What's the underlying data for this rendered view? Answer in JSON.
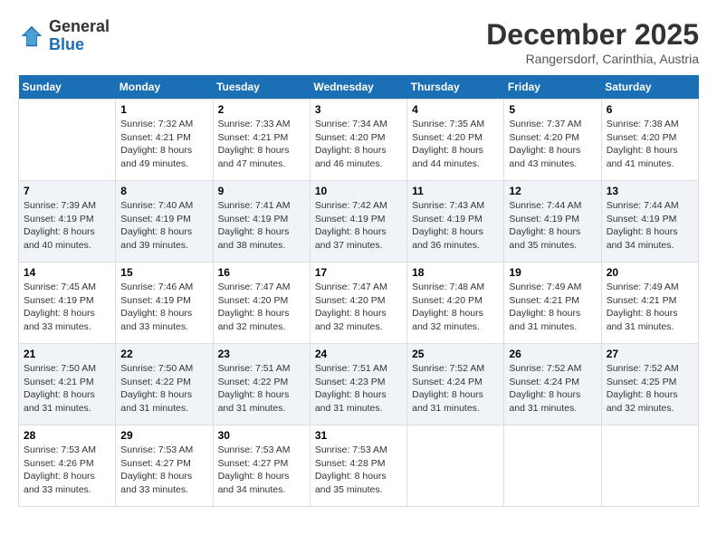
{
  "logo": {
    "general": "General",
    "blue": "Blue"
  },
  "title": "December 2025",
  "location": "Rangersdorf, Carinthia, Austria",
  "days_of_week": [
    "Sunday",
    "Monday",
    "Tuesday",
    "Wednesday",
    "Thursday",
    "Friday",
    "Saturday"
  ],
  "weeks": [
    [
      {
        "day": "",
        "sunrise": "",
        "sunset": "",
        "daylight": ""
      },
      {
        "day": "1",
        "sunrise": "Sunrise: 7:32 AM",
        "sunset": "Sunset: 4:21 PM",
        "daylight": "Daylight: 8 hours and 49 minutes."
      },
      {
        "day": "2",
        "sunrise": "Sunrise: 7:33 AM",
        "sunset": "Sunset: 4:21 PM",
        "daylight": "Daylight: 8 hours and 47 minutes."
      },
      {
        "day": "3",
        "sunrise": "Sunrise: 7:34 AM",
        "sunset": "Sunset: 4:20 PM",
        "daylight": "Daylight: 8 hours and 46 minutes."
      },
      {
        "day": "4",
        "sunrise": "Sunrise: 7:35 AM",
        "sunset": "Sunset: 4:20 PM",
        "daylight": "Daylight: 8 hours and 44 minutes."
      },
      {
        "day": "5",
        "sunrise": "Sunrise: 7:37 AM",
        "sunset": "Sunset: 4:20 PM",
        "daylight": "Daylight: 8 hours and 43 minutes."
      },
      {
        "day": "6",
        "sunrise": "Sunrise: 7:38 AM",
        "sunset": "Sunset: 4:20 PM",
        "daylight": "Daylight: 8 hours and 41 minutes."
      }
    ],
    [
      {
        "day": "7",
        "sunrise": "Sunrise: 7:39 AM",
        "sunset": "Sunset: 4:19 PM",
        "daylight": "Daylight: 8 hours and 40 minutes."
      },
      {
        "day": "8",
        "sunrise": "Sunrise: 7:40 AM",
        "sunset": "Sunset: 4:19 PM",
        "daylight": "Daylight: 8 hours and 39 minutes."
      },
      {
        "day": "9",
        "sunrise": "Sunrise: 7:41 AM",
        "sunset": "Sunset: 4:19 PM",
        "daylight": "Daylight: 8 hours and 38 minutes."
      },
      {
        "day": "10",
        "sunrise": "Sunrise: 7:42 AM",
        "sunset": "Sunset: 4:19 PM",
        "daylight": "Daylight: 8 hours and 37 minutes."
      },
      {
        "day": "11",
        "sunrise": "Sunrise: 7:43 AM",
        "sunset": "Sunset: 4:19 PM",
        "daylight": "Daylight: 8 hours and 36 minutes."
      },
      {
        "day": "12",
        "sunrise": "Sunrise: 7:44 AM",
        "sunset": "Sunset: 4:19 PM",
        "daylight": "Daylight: 8 hours and 35 minutes."
      },
      {
        "day": "13",
        "sunrise": "Sunrise: 7:44 AM",
        "sunset": "Sunset: 4:19 PM",
        "daylight": "Daylight: 8 hours and 34 minutes."
      }
    ],
    [
      {
        "day": "14",
        "sunrise": "Sunrise: 7:45 AM",
        "sunset": "Sunset: 4:19 PM",
        "daylight": "Daylight: 8 hours and 33 minutes."
      },
      {
        "day": "15",
        "sunrise": "Sunrise: 7:46 AM",
        "sunset": "Sunset: 4:19 PM",
        "daylight": "Daylight: 8 hours and 33 minutes."
      },
      {
        "day": "16",
        "sunrise": "Sunrise: 7:47 AM",
        "sunset": "Sunset: 4:20 PM",
        "daylight": "Daylight: 8 hours and 32 minutes."
      },
      {
        "day": "17",
        "sunrise": "Sunrise: 7:47 AM",
        "sunset": "Sunset: 4:20 PM",
        "daylight": "Daylight: 8 hours and 32 minutes."
      },
      {
        "day": "18",
        "sunrise": "Sunrise: 7:48 AM",
        "sunset": "Sunset: 4:20 PM",
        "daylight": "Daylight: 8 hours and 32 minutes."
      },
      {
        "day": "19",
        "sunrise": "Sunrise: 7:49 AM",
        "sunset": "Sunset: 4:21 PM",
        "daylight": "Daylight: 8 hours and 31 minutes."
      },
      {
        "day": "20",
        "sunrise": "Sunrise: 7:49 AM",
        "sunset": "Sunset: 4:21 PM",
        "daylight": "Daylight: 8 hours and 31 minutes."
      }
    ],
    [
      {
        "day": "21",
        "sunrise": "Sunrise: 7:50 AM",
        "sunset": "Sunset: 4:21 PM",
        "daylight": "Daylight: 8 hours and 31 minutes."
      },
      {
        "day": "22",
        "sunrise": "Sunrise: 7:50 AM",
        "sunset": "Sunset: 4:22 PM",
        "daylight": "Daylight: 8 hours and 31 minutes."
      },
      {
        "day": "23",
        "sunrise": "Sunrise: 7:51 AM",
        "sunset": "Sunset: 4:22 PM",
        "daylight": "Daylight: 8 hours and 31 minutes."
      },
      {
        "day": "24",
        "sunrise": "Sunrise: 7:51 AM",
        "sunset": "Sunset: 4:23 PM",
        "daylight": "Daylight: 8 hours and 31 minutes."
      },
      {
        "day": "25",
        "sunrise": "Sunrise: 7:52 AM",
        "sunset": "Sunset: 4:24 PM",
        "daylight": "Daylight: 8 hours and 31 minutes."
      },
      {
        "day": "26",
        "sunrise": "Sunrise: 7:52 AM",
        "sunset": "Sunset: 4:24 PM",
        "daylight": "Daylight: 8 hours and 31 minutes."
      },
      {
        "day": "27",
        "sunrise": "Sunrise: 7:52 AM",
        "sunset": "Sunset: 4:25 PM",
        "daylight": "Daylight: 8 hours and 32 minutes."
      }
    ],
    [
      {
        "day": "28",
        "sunrise": "Sunrise: 7:53 AM",
        "sunset": "Sunset: 4:26 PM",
        "daylight": "Daylight: 8 hours and 33 minutes."
      },
      {
        "day": "29",
        "sunrise": "Sunrise: 7:53 AM",
        "sunset": "Sunset: 4:27 PM",
        "daylight": "Daylight: 8 hours and 33 minutes."
      },
      {
        "day": "30",
        "sunrise": "Sunrise: 7:53 AM",
        "sunset": "Sunset: 4:27 PM",
        "daylight": "Daylight: 8 hours and 34 minutes."
      },
      {
        "day": "31",
        "sunrise": "Sunrise: 7:53 AM",
        "sunset": "Sunset: 4:28 PM",
        "daylight": "Daylight: 8 hours and 35 minutes."
      },
      {
        "day": "",
        "sunrise": "",
        "sunset": "",
        "daylight": ""
      },
      {
        "day": "",
        "sunrise": "",
        "sunset": "",
        "daylight": ""
      },
      {
        "day": "",
        "sunrise": "",
        "sunset": "",
        "daylight": ""
      }
    ]
  ]
}
